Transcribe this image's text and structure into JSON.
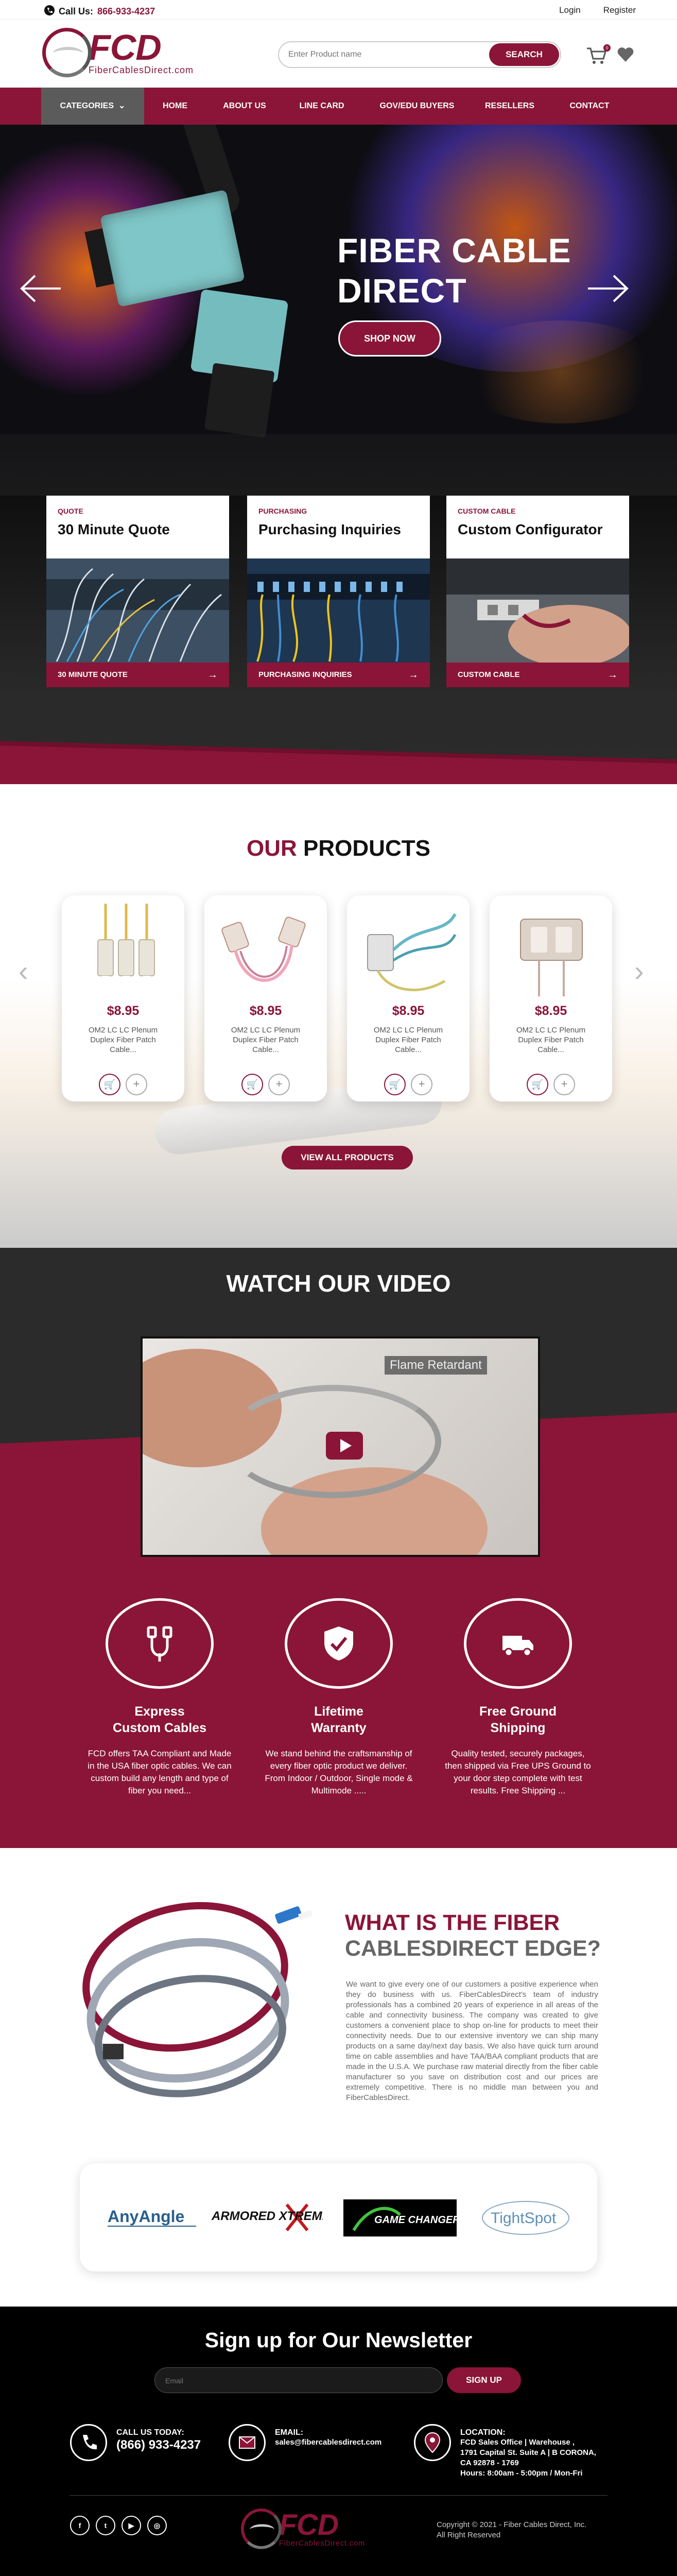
{
  "topbar": {
    "call_label": "Call Us:",
    "phone": "866-933-4237",
    "login": "Login",
    "register": "Register"
  },
  "header": {
    "logo_text": "FCD",
    "logo_sub": "FiberCablesDirect.com",
    "search_placeholder": "Enter Product name",
    "search_button": "SEARCH",
    "cart_count": "0",
    "cart_icon": "cart-icon",
    "heart_icon": "heart-icon"
  },
  "nav": {
    "items": [
      "CATEGORIES",
      "HOME",
      "ABOUT US",
      "LINE CARD",
      "GOV/EDU BUYERS",
      "RESELLERS",
      "CONTACT"
    ]
  },
  "hero": {
    "title_line1": "FIBER CABLE",
    "title_line2": "DIRECT",
    "button": "SHOP NOW"
  },
  "cards": [
    {
      "tag": "QUOTE",
      "title": "30 Minute Quote",
      "bar": "30 MINUTE QUOTE"
    },
    {
      "tag": "PURCHASING",
      "title": "Purchasing Inquiries",
      "bar": "PURCHASING INQUIRIES"
    },
    {
      "tag": "CUSTOM CABLE",
      "title": "Custom Configurator",
      "bar": "CUSTOM CABLE"
    }
  ],
  "products": {
    "heading_accent": "OUR",
    "heading_rest": "PRODUCTS",
    "items": [
      {
        "price": "$8.95",
        "name": "OM2 LC LC Plenum Duplex Fiber Patch Cable..."
      },
      {
        "price": "$8.95",
        "name": "OM2 LC LC Plenum Duplex Fiber Patch Cable..."
      },
      {
        "price": "$8.95",
        "name": "OM2 LC LC Plenum Duplex Fiber Patch Cable..."
      },
      {
        "price": "$8.95",
        "name": "OM2 LC LC Plenum Duplex Fiber Patch Cable..."
      }
    ],
    "view_all": "VIEW ALL PRODUCTS"
  },
  "video": {
    "heading": "WATCH OUR VIDEO",
    "overlay_label": "Flame Retardant",
    "features": [
      {
        "title_l1": "Express",
        "title_l2": "Custom Cables",
        "text": "FCD offers TAA Compliant and Made in the USA fiber optic cables. We can custom build any length and type of fiber you need..."
      },
      {
        "title_l1": "Lifetime",
        "title_l2": "Warranty",
        "text": "We stand behind the craftsmanship of every fiber optic product we deliver. From Indoor / Outdoor, Single mode & Multimode ....."
      },
      {
        "title_l1": "Free Ground",
        "title_l2": "Shipping",
        "text": "Quality tested, securely packages, then shipped via Free UPS Ground to your door step complete with test results. Free Shipping ..."
      }
    ]
  },
  "edge": {
    "heading_l1": "WHAT IS THE FIBER",
    "heading_l2": "CABLESDIRECT EDGE?",
    "body": "We want to give every one of our customers a positive experience when they do business with us. FiberCablesDirect's team of industry professionals has a combined 20 years of experience in all areas of the cable and connectivity business. The company was created to give customers a convenient place to shop on-line for products to meet their connectivity needs. Due to our extensive inventory we can ship many products on a same day/next day basis. We also have quick turn around time on cable assemblies and have TAA/BAA compliant products that are made in the U.S.A. We purchase raw material directly from the fiber cable manufacturer so you save on distribution cost and our prices are extremely competitive. There is no middle man between you and FiberCablesDirect.",
    "brands": [
      "AnyAngle",
      "ARMORED XTREME",
      "GAME CHANGER",
      "TightSpot"
    ]
  },
  "footer": {
    "newsletter_heading": "Sign up for Our Newsletter",
    "email_placeholder": "Email",
    "signup_button": "SIGN UP",
    "call_label": "CALL US TODAY:",
    "call_value": "(866) 933-4237",
    "email_label": "EMAIL:",
    "email_value": "sales@fibercablesdirect.com",
    "location_label": "LOCATION:",
    "location_l1": "FCD Sales Office | Warehouse ,",
    "location_l2": "1791 Capital St. Suite A | B CORONA,",
    "location_l3": "CA 92878 - 1769",
    "location_l4": "Hours: 8:00am - 5:00pm / Mon-Fri",
    "social": [
      "f",
      "t",
      "▶",
      "◎"
    ],
    "copyright_l1": "Copyright © 2021 - Fiber Cables Direct, Inc.",
    "copyright_l2": "All Right Reserved",
    "accent": "#8a1538"
  }
}
